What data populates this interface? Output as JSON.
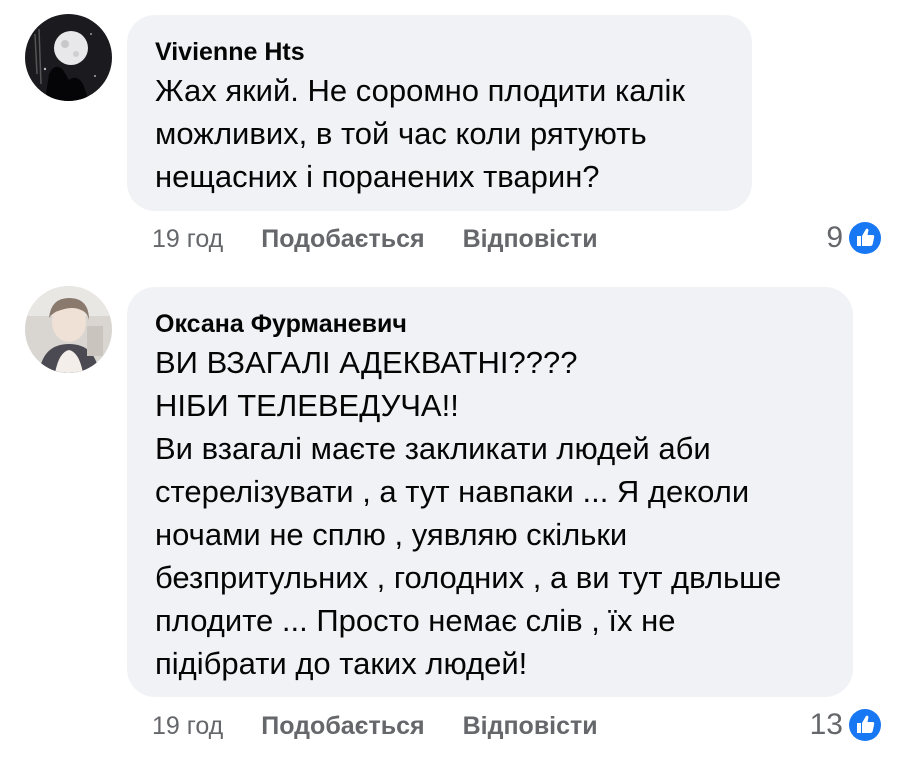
{
  "comments": [
    {
      "author": "Vivienne Hts",
      "lines": [
        "Жах який. Не соромно плодити калік",
        "можливих, в той час коли рятують",
        "нещасних і поранених тварин?"
      ],
      "time": "19 год",
      "like_label": "Подобається",
      "reply_label": "Відповісти",
      "reaction_count": "9",
      "reaction_icon": "like-icon"
    },
    {
      "author": "Оксана Фурманевич",
      "lines": [
        "ВИ ВЗАГАЛІ АДЕКВАТНІ????",
        "НІБИ ТЕЛЕВЕДУЧА!!",
        "Ви взагалі маєте закликати людей аби",
        "стерелізувати , а тут навпаки ... Я деколи",
        "ночами не сплю , уявляю скільки",
        "безпритульних , голодних , а ви тут двльше",
        "плодите ... Просто немає слів , їх не",
        "підібрати до таких людей!"
      ],
      "time": "19 год",
      "like_label": "Подобається",
      "reply_label": "Відповісти",
      "reaction_count": "13",
      "reaction_icon": "like-icon"
    }
  ],
  "colors": {
    "bubble": "#f0f2f5",
    "text": "#050505",
    "secondary": "#65676b",
    "like_blue": "#1877f2"
  }
}
